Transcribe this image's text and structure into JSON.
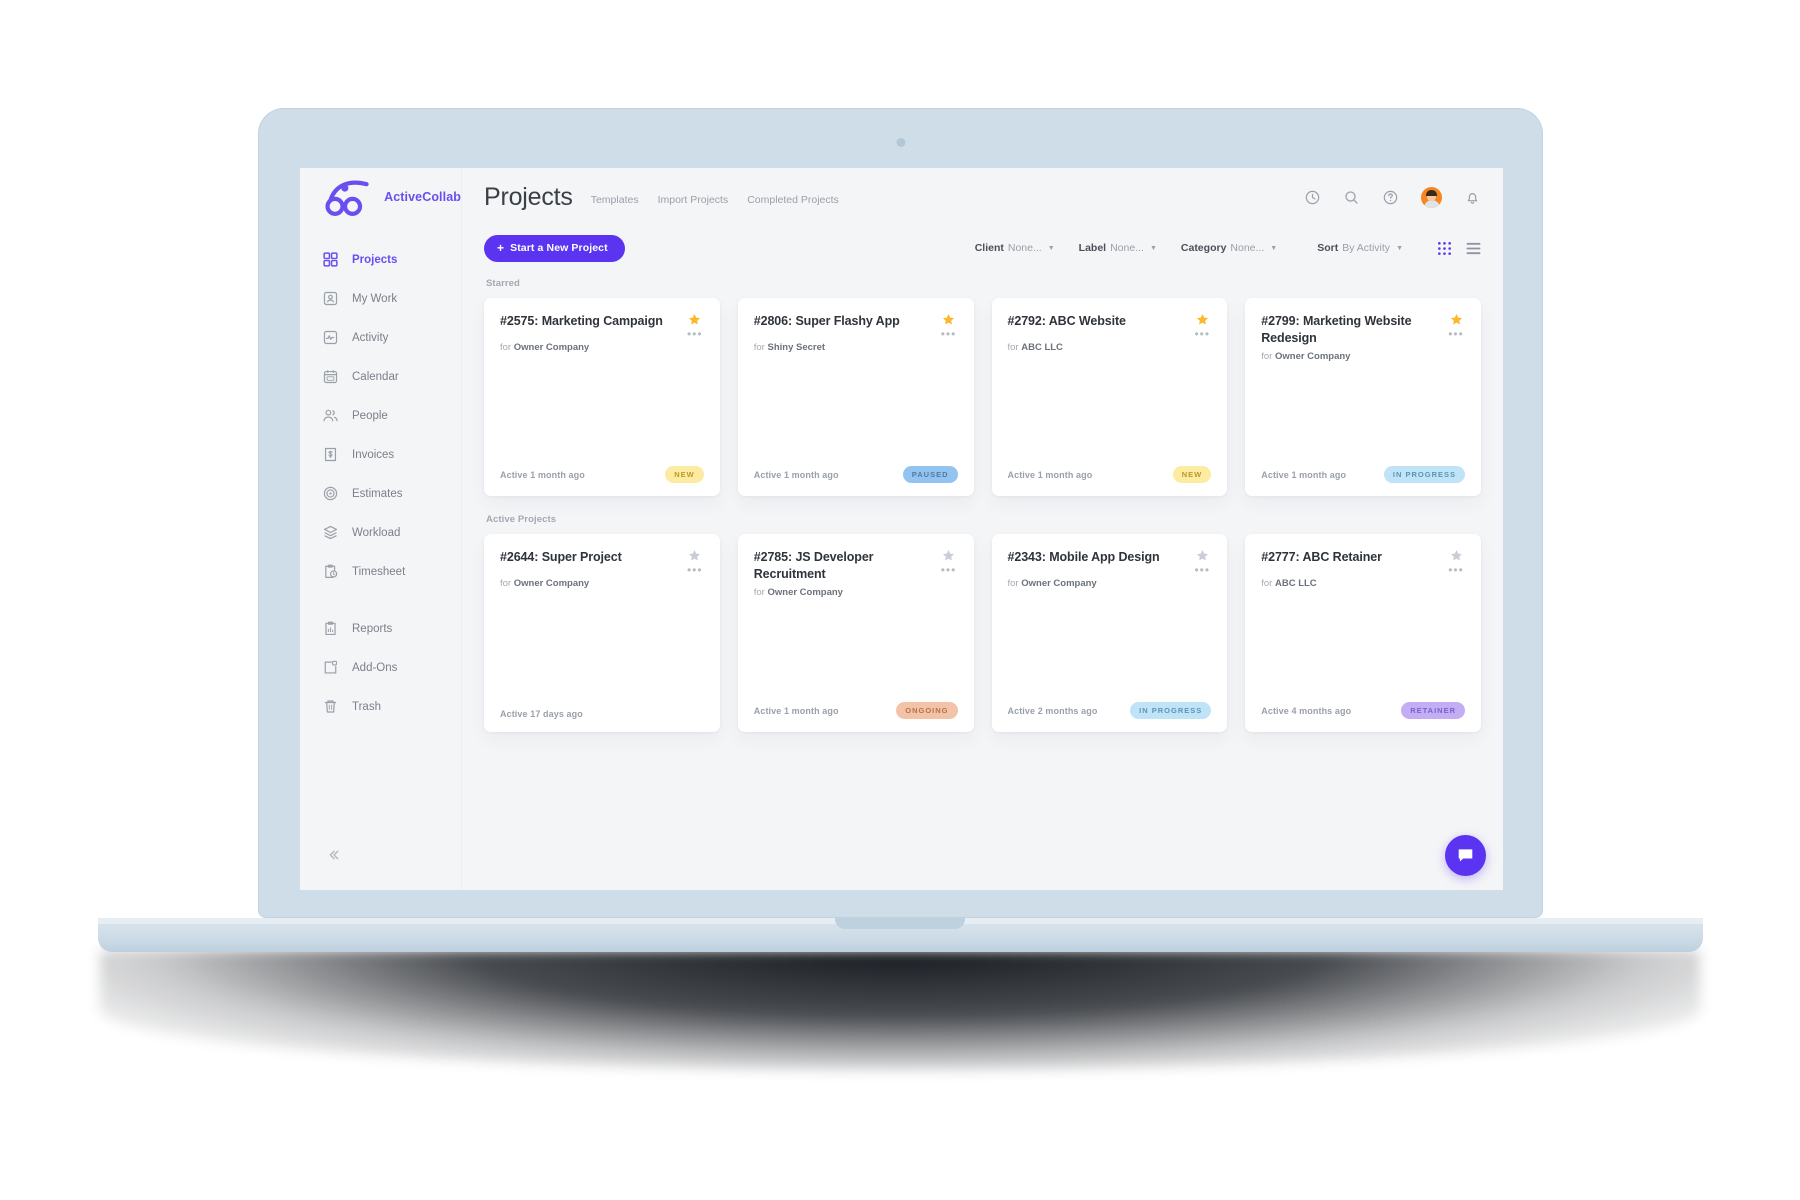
{
  "brand": {
    "name": "ActiveCollab",
    "logo_icon": "activecollab-logo-icon",
    "accent": "#6a4ef0"
  },
  "sidebar": {
    "collapse_icon": "chevron-double-left-icon",
    "items": [
      {
        "label": "Projects",
        "icon": "grid-icon",
        "active": true
      },
      {
        "label": "My Work",
        "icon": "user-card-icon",
        "active": false
      },
      {
        "label": "Activity",
        "icon": "pulse-icon",
        "active": false
      },
      {
        "label": "Calendar",
        "icon": "calendar-icon",
        "active": false
      },
      {
        "label": "People",
        "icon": "people-icon",
        "active": false
      },
      {
        "label": "Invoices",
        "icon": "invoice-icon",
        "active": false
      },
      {
        "label": "Estimates",
        "icon": "target-icon",
        "active": false
      },
      {
        "label": "Workload",
        "icon": "layers-icon",
        "active": false
      },
      {
        "label": "Timesheet",
        "icon": "timesheet-icon",
        "active": false
      }
    ],
    "items_secondary": [
      {
        "label": "Reports",
        "icon": "report-icon"
      },
      {
        "label": "Add-Ons",
        "icon": "addons-icon"
      },
      {
        "label": "Trash",
        "icon": "trash-icon"
      }
    ]
  },
  "header": {
    "title": "Projects",
    "links": [
      {
        "label": "Templates"
      },
      {
        "label": "Import Projects"
      },
      {
        "label": "Completed Projects"
      }
    ],
    "icons": [
      {
        "name": "timer-icon"
      },
      {
        "name": "search-icon"
      },
      {
        "name": "help-icon"
      },
      {
        "name": "avatar"
      },
      {
        "name": "bell-icon"
      }
    ]
  },
  "toolbar": {
    "new_project_label": "Start a New Project",
    "new_project_plus": "+",
    "filters": [
      {
        "key": "Client",
        "value": "None..."
      },
      {
        "key": "Label",
        "value": "None..."
      },
      {
        "key": "Category",
        "value": "None..."
      },
      {
        "key": "Sort",
        "value": "By Activity"
      }
    ],
    "views": [
      {
        "name": "grid-view-toggle",
        "active": true
      },
      {
        "name": "list-view-toggle",
        "active": false
      }
    ]
  },
  "sections": [
    {
      "label": "Starred",
      "cards": [
        {
          "title": "#2575: Marketing Campaign",
          "client_prefix": "for",
          "client": "Owner Company",
          "starred": true,
          "active": "Active 1 month ago",
          "badge": "NEW",
          "badge_bg": "#fdeba1",
          "badge_fg": "#b89a2b"
        },
        {
          "title": "#2806: Super Flashy App",
          "client_prefix": "for",
          "client": "Shiny Secret",
          "starred": true,
          "active": "Active 1 month ago",
          "badge": "PAUSED",
          "badge_bg": "#93c3ef",
          "badge_fg": "#4e7ba8"
        },
        {
          "title": "#2792: ABC Website",
          "client_prefix": "for",
          "client": "ABC LLC",
          "starred": true,
          "active": "Active 1 month ago",
          "badge": "NEW",
          "badge_bg": "#fdeba1",
          "badge_fg": "#b89a2b"
        },
        {
          "title": "#2799: Marketing Website Redesign",
          "client_prefix": "for",
          "client": "Owner Company",
          "starred": true,
          "active": "Active 1 month ago",
          "badge": "IN PROGRESS",
          "badge_bg": "#bfe4f7",
          "badge_fg": "#5f93b3"
        }
      ]
    },
    {
      "label": "Active Projects",
      "cards": [
        {
          "title": "#2644: Super Project",
          "client_prefix": "for",
          "client": "Owner Company",
          "starred": false,
          "active": "Active 17 days ago",
          "badge": "",
          "badge_bg": "",
          "badge_fg": ""
        },
        {
          "title": "#2785: JS Developer Recruitment",
          "client_prefix": "for",
          "client": "Owner Company",
          "starred": false,
          "active": "Active 1 month ago",
          "badge": "ONGOING",
          "badge_bg": "#f3c3a8",
          "badge_fg": "#b5734c"
        },
        {
          "title": "#2343: Mobile App Design",
          "client_prefix": "for",
          "client": "Owner Company",
          "starred": false,
          "active": "Active 2 months ago",
          "badge": "IN PROGRESS",
          "badge_bg": "#bfe4f7",
          "badge_fg": "#5f93b3"
        },
        {
          "title": "#2777: ABC Retainer",
          "client_prefix": "for",
          "client": "ABC LLC",
          "starred": false,
          "active": "Active 4 months ago",
          "badge": "RETAINER",
          "badge_bg": "#c3aef5",
          "badge_fg": "#7a62c9"
        }
      ]
    }
  ],
  "chat": {
    "icon": "chat-bubble-icon",
    "color": "#5a34f0"
  },
  "colors": {
    "purple": "#5a34f0",
    "star_on": "#fcb72b",
    "star_off": "#c9ced6",
    "page_bg": "#f4f5f7",
    "laptop": "#cfdde8"
  }
}
